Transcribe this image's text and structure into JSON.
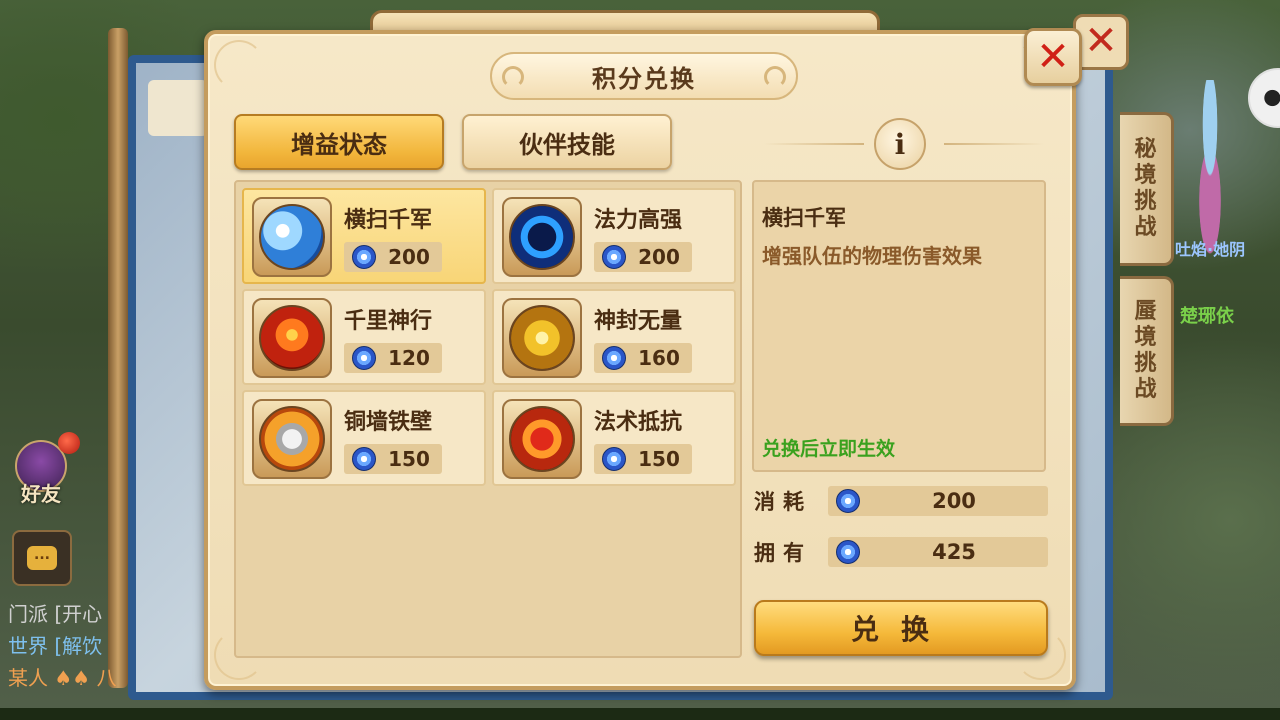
{
  "background": {
    "side_tabs": [
      "秘境挑战",
      "蜃境挑战"
    ],
    "npc_title": "吐焰·她阴",
    "npc_name": "楚琊依",
    "friend_label": "好友",
    "chat_bubble": "...",
    "chat_log": [
      "门派 [开心",
      "世界 [解饮",
      "某人 ♠♠ 八"
    ]
  },
  "dialog": {
    "title": "积分兑换",
    "close_icon": "close-x-icon",
    "tabs": [
      {
        "label": "增益状态",
        "active": true
      },
      {
        "label": "伙伴技能",
        "active": false
      }
    ],
    "info_icon": "i",
    "skills": [
      {
        "name": "横扫千军",
        "cost": "200",
        "icon": "sword-sweep-icon",
        "selected": true
      },
      {
        "name": "法力高强",
        "cost": "200",
        "icon": "magic-skull-icon",
        "selected": false
      },
      {
        "name": "千里神行",
        "cost": "120",
        "icon": "phoenix-speed-icon",
        "selected": false
      },
      {
        "name": "神封无量",
        "cost": "160",
        "icon": "golden-bell-icon",
        "selected": false
      },
      {
        "name": "铜墙铁壁",
        "cost": "150",
        "icon": "shield-icon",
        "selected": false
      },
      {
        "name": "法术抵抗",
        "cost": "150",
        "icon": "fire-resist-icon",
        "selected": false
      }
    ],
    "detail": {
      "title": "横扫千军",
      "description": "增强队伍的物理伤害效果",
      "effect_note": "兑换后立即生效"
    },
    "consume": {
      "label": "消耗",
      "value": "200"
    },
    "own": {
      "label": "拥有",
      "value": "425"
    },
    "exchange_label": "兑换"
  },
  "colors": {
    "panel_bg": "#f6e8c8",
    "active_tab": "#f2b63c",
    "effect_green": "#3aa11e",
    "close_red": "#d02016"
  }
}
